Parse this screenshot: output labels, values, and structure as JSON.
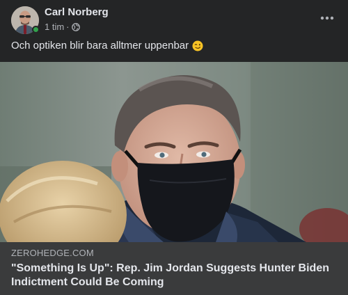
{
  "post": {
    "author": "Carl Norberg",
    "time": "1 tim",
    "separator": "·",
    "text": "Och optiken blir bara alltmer uppenbar",
    "emoji": "winking-face-icon"
  },
  "link": {
    "domain": "ZEROHEDGE.COM",
    "title": "\"Something Is Up\": Rep. Jim Jordan Suggests Hunter Biden Indictment Could Be Coming"
  },
  "colors": {
    "background": "#242526",
    "link_box": "#3a3b3c",
    "primary_text": "#e4e6eb",
    "secondary_text": "#b0b3b8",
    "online": "#31a24c"
  }
}
